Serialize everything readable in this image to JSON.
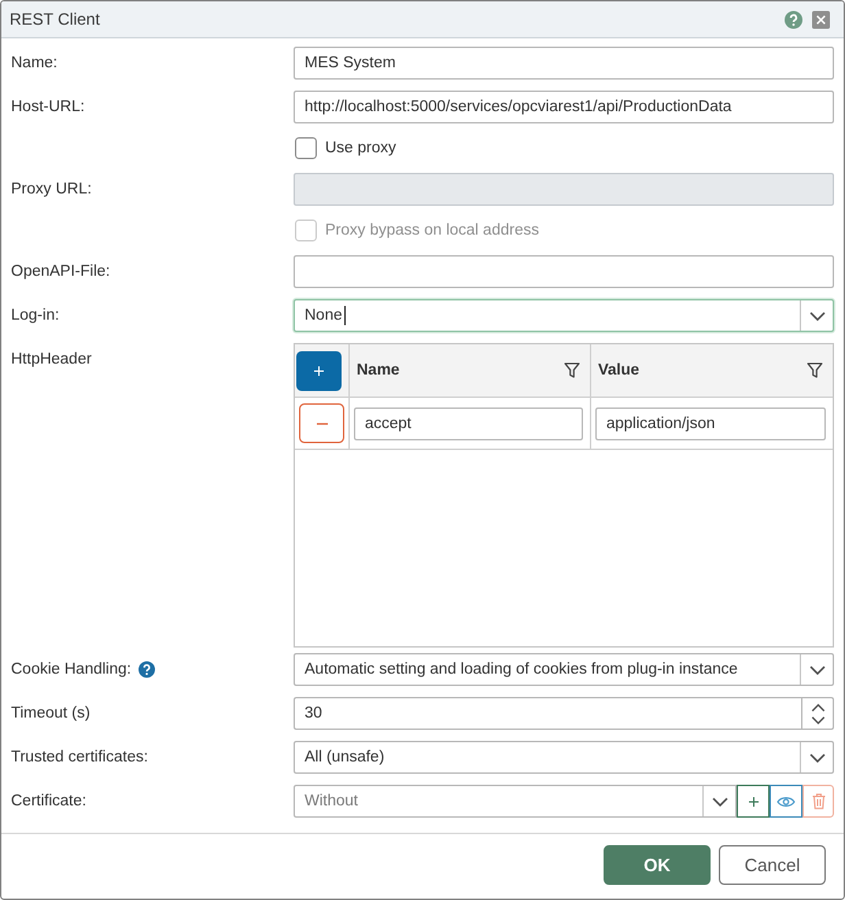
{
  "window": {
    "title": "REST Client"
  },
  "fields": [
    {
      "kind": "text",
      "label": "Name:",
      "value": "MES System",
      "disabled": false,
      "focused": false
    },
    {
      "kind": "text",
      "label": "Host-URL:",
      "value": "http://localhost:5000/services/opcviarest1/api/ProductionData",
      "disabled": false,
      "focused": false
    },
    {
      "kind": "checkbox",
      "text": "Use proxy",
      "checked": false,
      "disabled": false,
      "focused": false
    },
    {
      "kind": "text",
      "label": "Proxy URL:",
      "disabled": true,
      "focused": false
    },
    {
      "kind": "checkbox",
      "text": "Proxy bypass on local address",
      "checked": false,
      "disabled": true,
      "focused": false
    },
    {
      "kind": "text",
      "label": "OpenAPI-File:",
      "disabled": false,
      "focused": false
    },
    {
      "kind": "select",
      "label": "Log-in:",
      "value": "None",
      "disabled": false,
      "focused": true
    },
    {
      "kind": "grid",
      "label": "HttpHeader",
      "columns": [
        {
          "label": "Name"
        },
        {
          "label": "Value"
        }
      ],
      "rows": [
        {
          "cells": [
            "accept",
            "application/json"
          ]
        }
      ],
      "disabled": false,
      "focused": false
    },
    {
      "kind": "select",
      "label": "Cookie Handling:",
      "help": true,
      "value": "Automatic setting and loading of cookies from plug-in instance",
      "disabled": false,
      "focused": false
    },
    {
      "kind": "spinner",
      "label": "Timeout (s)",
      "value": "30",
      "disabled": false,
      "focused": false
    },
    {
      "kind": "select",
      "label": "Trusted certificates:",
      "value": "All (unsafe)",
      "disabled": false,
      "focused": false
    },
    {
      "kind": "picker",
      "label": "Certificate:",
      "placeholder": "Without",
      "disabled": false,
      "focused": false
    }
  ],
  "buttons": [
    {
      "label": "OK",
      "kind": "primary"
    },
    {
      "label": "Cancel",
      "kind": "secondary"
    }
  ]
}
